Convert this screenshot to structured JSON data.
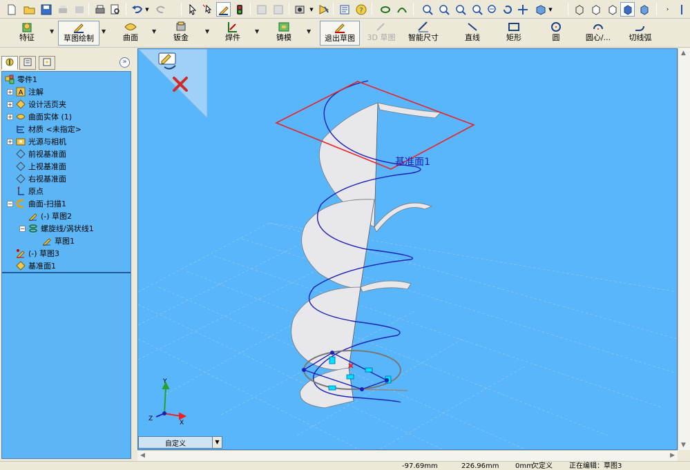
{
  "toolbar": {
    "icons": [
      "new-icon",
      "open-icon",
      "save-icon",
      "print-icon",
      "print-preview-icon",
      "undo-icon",
      "redo-icon",
      "select-icon",
      "smart-select-icon",
      "edit-sketch-icon",
      "traffic-light-icon",
      "grid-icon",
      "grid2-icon",
      "view-icon",
      "material-icon",
      "properties-icon",
      "help-icon",
      "rebuild-icon",
      "sketch-feature-icon",
      "zoom-fit-icon",
      "zoom-area-icon",
      "zoom-prev-icon",
      "zoom-in-icon",
      "rotate-icon",
      "pan-icon",
      "view-orientation-icon",
      "wireframe-icon",
      "hidden-lines-icon",
      "shaded-edges-icon",
      "shaded-icon",
      "perspective-icon"
    ]
  },
  "command_manager": {
    "buttons": [
      {
        "label": "特征",
        "icon": "features-icon"
      },
      {
        "label": "草图绘制",
        "icon": "sketch-icon"
      },
      {
        "label": "曲面",
        "icon": "surface-icon"
      },
      {
        "label": "钣金",
        "icon": "sheet-metal-icon"
      },
      {
        "label": "焊件",
        "icon": "weldment-icon"
      },
      {
        "label": "铸模",
        "icon": "mold-icon"
      },
      {
        "label": "退出草图",
        "icon": "exit-sketch-icon"
      },
      {
        "label": "3D 草图",
        "icon": "sketch-3d-icon"
      },
      {
        "label": "智能尺寸",
        "icon": "smart-dimension-icon"
      },
      {
        "label": "直线",
        "icon": "line-icon"
      },
      {
        "label": "矩形",
        "icon": "rectangle-icon"
      },
      {
        "label": "圆",
        "icon": "circle-icon"
      },
      {
        "label": "圆心/...",
        "icon": "center-arc-icon"
      },
      {
        "label": "切线弧",
        "icon": "tangent-arc-icon"
      }
    ]
  },
  "feature_tree": {
    "root": "零件1",
    "items": [
      {
        "label": "注解"
      },
      {
        "label": "设计活页夹"
      },
      {
        "label": "曲面实体 (1)"
      },
      {
        "label": "材质 <未指定>"
      },
      {
        "label": "光源与相机"
      },
      {
        "label": "前视基准面"
      },
      {
        "label": "上视基准面"
      },
      {
        "label": "右视基准面"
      },
      {
        "label": "原点"
      },
      {
        "label": "曲面-扫描1"
      },
      {
        "label": "(-) 草图2"
      },
      {
        "label": "螺旋线/涡状线1"
      },
      {
        "label": "草图1"
      },
      {
        "label": "(-) 草图3"
      },
      {
        "label": "基准面1"
      }
    ]
  },
  "viewport": {
    "plane_label": "基准面1",
    "view_select": "自定义",
    "triad": {
      "x": "X",
      "y": "Y",
      "z": "Z"
    },
    "colors": {
      "background": "#59b6fb",
      "plane": "#e8232a",
      "helix": "#1b1fb4",
      "surface": "#e6e6ea"
    }
  },
  "statusbar": {
    "x": "-97.69mm",
    "y": "226.96mm",
    "z": "0mm",
    "mode": "欠定义",
    "editing": "正在编辑：草图3"
  }
}
